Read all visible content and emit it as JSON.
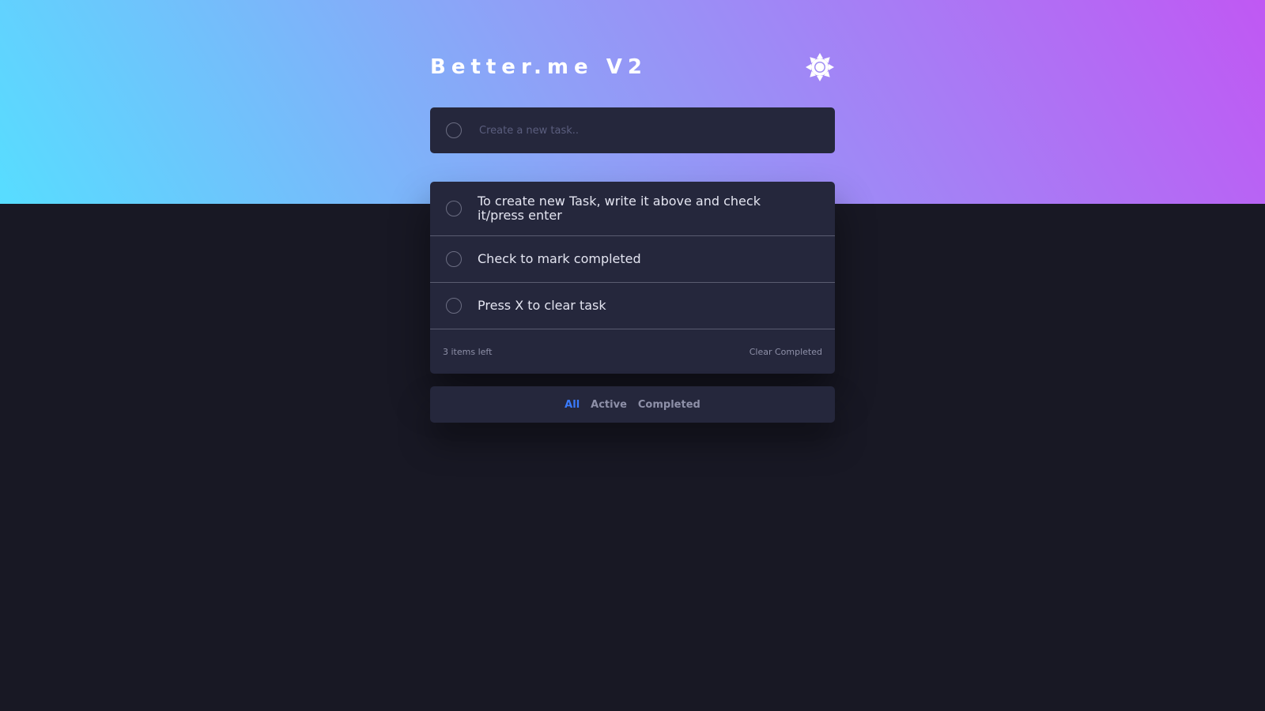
{
  "app": {
    "title": "Better.me V2",
    "theme_icon": "sun-icon"
  },
  "new_task": {
    "placeholder": "Create a new task..",
    "value": ""
  },
  "tasks": [
    {
      "text": "To create new Task, write it above and check it/press enter",
      "completed": false
    },
    {
      "text": "Check to mark completed",
      "completed": false
    },
    {
      "text": "Press X to clear task",
      "completed": false
    }
  ],
  "footer": {
    "items_left": "3 items left",
    "clear_label": "Clear Completed"
  },
  "filters": {
    "all": "All",
    "active": "Active",
    "completed": "Completed",
    "selected": "All"
  },
  "colors": {
    "gradient_start": "#57ddff",
    "gradient_end": "#c058f3",
    "background": "#181824",
    "card": "#25273c",
    "accent": "#3a7bfd"
  }
}
